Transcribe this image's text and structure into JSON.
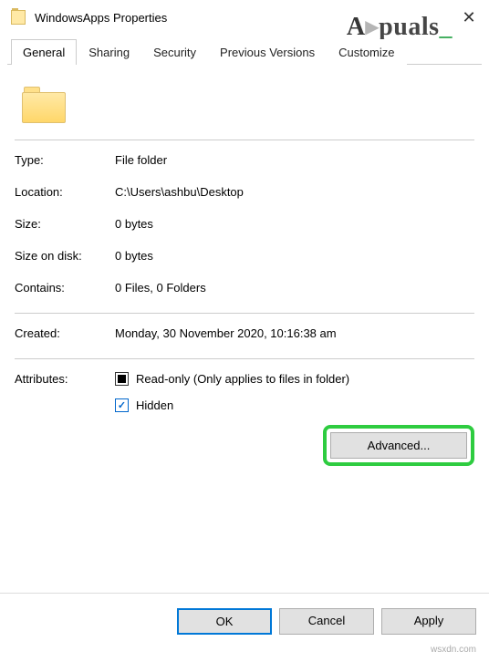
{
  "title": "WindowsApps Properties",
  "watermark": "Appuals",
  "tabs": {
    "general": "General",
    "sharing": "Sharing",
    "security": "Security",
    "previous": "Previous Versions",
    "customize": "Customize"
  },
  "fields": {
    "type_label": "Type:",
    "type_value": "File folder",
    "location_label": "Location:",
    "location_value": "C:\\Users\\ashbu\\Desktop",
    "size_label": "Size:",
    "size_value": "0 bytes",
    "sizedisk_label": "Size on disk:",
    "sizedisk_value": "0 bytes",
    "contains_label": "Contains:",
    "contains_value": "0 Files, 0 Folders",
    "created_label": "Created:",
    "created_value": "Monday, 30 November 2020, 10:16:38 am",
    "attributes_label": "Attributes:",
    "readonly_label": "Read-only (Only applies to files in folder)",
    "hidden_label": "Hidden",
    "advanced_label": "Advanced..."
  },
  "buttons": {
    "ok": "OK",
    "cancel": "Cancel",
    "apply": "Apply"
  },
  "tinytext": "wsxdn.com"
}
